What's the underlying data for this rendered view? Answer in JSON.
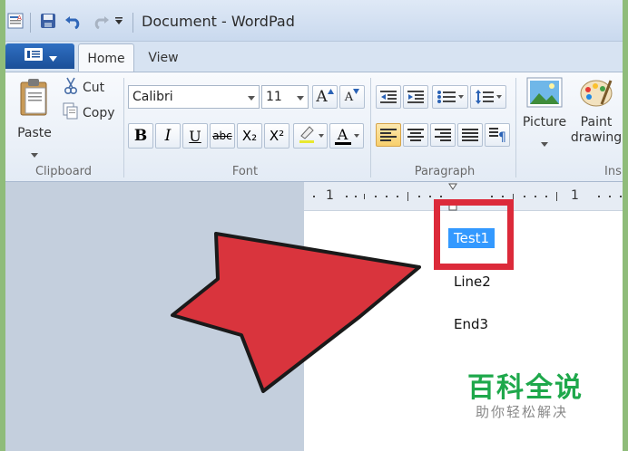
{
  "window": {
    "title": "Document - WordPad"
  },
  "quick_access": {
    "icons": [
      "wordpad-app-icon",
      "save-icon",
      "undo-icon",
      "redo-icon",
      "customize-qat-icon"
    ]
  },
  "tabs": [
    {
      "label": "Home",
      "active": true
    },
    {
      "label": "View",
      "active": false
    }
  ],
  "clipboard": {
    "paste": "Paste",
    "cut": "Cut",
    "copy": "Copy",
    "group": "Clipboard"
  },
  "font": {
    "family": "Calibri",
    "size": "11",
    "group": "Font",
    "bold": "B",
    "italic": "I",
    "underline": "U",
    "strike": "abc",
    "subscript": "X₂",
    "superscript": "X²",
    "color_letter": "A",
    "grow": "A",
    "shrink": "A"
  },
  "paragraph": {
    "group": "Paragraph"
  },
  "insert": {
    "picture": "Picture",
    "paint_line1": "Paint",
    "paint_line2": "drawing",
    "group_partial": "Ins"
  },
  "ruler": {
    "marks": [
      "1",
      "1"
    ]
  },
  "document": {
    "lines": [
      "Test1",
      "Line2",
      "End3"
    ],
    "selected_line": "Test1"
  },
  "colors": {
    "accent": "#1b4f98",
    "selection": "#3399ff",
    "highlight_box": "#dc2a3a",
    "arrow": "#d9343d",
    "watermark": "#1ea84b"
  },
  "watermark": {
    "title": "百科全说",
    "subtitle": "助你轻松解决"
  }
}
